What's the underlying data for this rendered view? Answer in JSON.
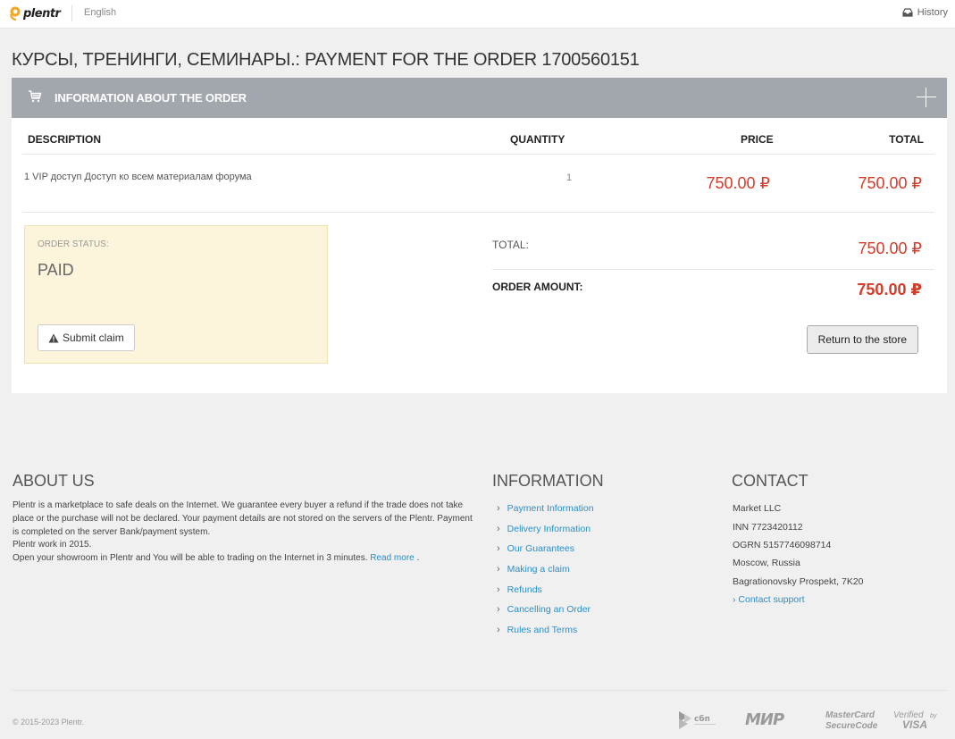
{
  "topbar": {
    "logo_text": "plentr",
    "language": "English",
    "history_label": "History",
    "icons": {
      "history": "inbox-icon",
      "logo": "plentr-logo-mark"
    }
  },
  "page": {
    "title": "КУРСЫ, ТРЕНИНГИ, СЕМИНАРЫ.: PAYMENT FOR THE ORDER 1700560151"
  },
  "order": {
    "header_title": "INFORMATION ABOUT THE ORDER",
    "header_icons": {
      "left": "cart-icon",
      "right": "plus-icon"
    },
    "columns": {
      "description": "DESCRIPTION",
      "quantity": "QUANTITY",
      "price": "PRICE",
      "total": "TOTAL"
    },
    "items": [
      {
        "description": "1 VIP доступ Доступ ко всем материалам форума",
        "quantity": "1",
        "price": "750.00 ₽",
        "total": "750.00 ₽"
      }
    ],
    "status": {
      "label": "ORDER STATUS:",
      "value": "PAID",
      "claim_button": "Submit claim"
    },
    "summary": {
      "total_label": "TOTAL:",
      "total_value": "750.00 ₽",
      "amount_label": "ORDER AMOUNT:",
      "amount_value": "750.00 ₽"
    },
    "return_button": "Return to the store"
  },
  "footer": {
    "about": {
      "heading": "ABOUT US",
      "lines": [
        "Plentr is a marketplace to safe deals on the Internet. We guarantee every buyer a refund if the trade does not take place or the purchase will not be declared. Your payment details are not stored on the servers of the Plentr. Payment is completed on the server Bank/payment system.",
        "Plentr work in 2015.",
        "Open your showroom in Plentr and You will be able to trading on the Internet in 3 minutes."
      ],
      "read_more": "Read more"
    },
    "information": {
      "heading": "INFORMATION",
      "links": [
        "Payment Information",
        "Delivery Information",
        "Our Guarantees",
        "Making a claim",
        "Refunds",
        "Cancelling an Order",
        "Rules and Terms"
      ]
    },
    "contact": {
      "heading": "CONTACT",
      "lines": [
        "Market LLC",
        "INN 7723420112",
        "OGRN 5157746098714",
        "Moscow, Russia",
        "Bagrationovsky Prospekt, 7K20"
      ],
      "support_link": "Contact support"
    },
    "copyright": "© 2015-2023 Plentr.",
    "payment_logos": {
      "sbp": "сбп",
      "mir": "МИР",
      "mastercard_1": "MasterCard",
      "mastercard_2": "SecureCode",
      "visa_1": "Verified",
      "visa_by": "by",
      "visa_2": "VISA"
    }
  },
  "colors": {
    "accent_price": "#d23c2a",
    "link": "#2a8fc8",
    "header_bar": "#a2a7ad",
    "status_bg": "#fdf4dc"
  }
}
